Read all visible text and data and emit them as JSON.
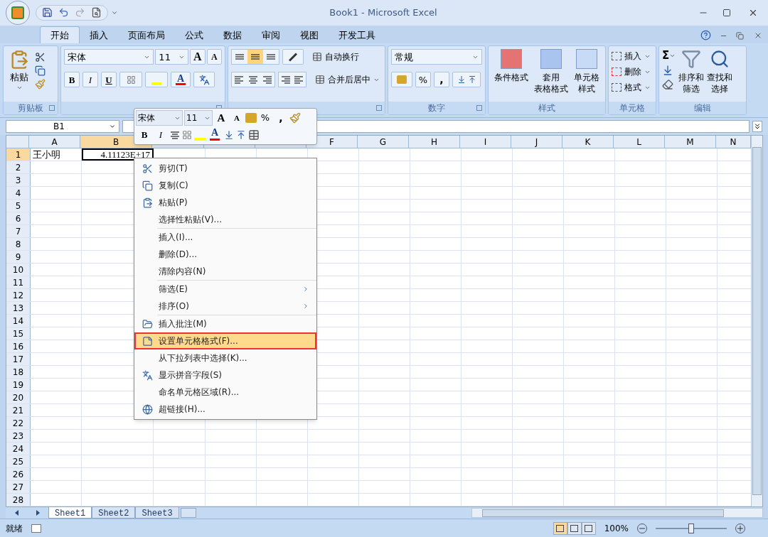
{
  "window": {
    "title": "Book1 - Microsoft Excel"
  },
  "tabs": [
    {
      "label": "开始",
      "selected": true
    },
    {
      "label": "插入",
      "selected": false
    },
    {
      "label": "页面布局",
      "selected": false
    },
    {
      "label": "公式",
      "selected": false
    },
    {
      "label": "数据",
      "selected": false
    },
    {
      "label": "审阅",
      "selected": false
    },
    {
      "label": "视图",
      "selected": false
    },
    {
      "label": "开发工具",
      "selected": false
    }
  ],
  "ribbon": {
    "clipboard": {
      "paste": "粘贴",
      "group": "剪贴板"
    },
    "font": {
      "name": "宋体",
      "size": "11",
      "grow": "A",
      "shrink": "A",
      "bold": "B",
      "italic": "I",
      "underline": "U",
      "font_color": "A"
    },
    "alignment": {
      "vertical": [
        {
          "selected": false
        },
        {
          "selected": true
        },
        {
          "selected": false
        }
      ],
      "wrap": "自动换行",
      "merge": "合并后居中"
    },
    "number": {
      "format": "常规",
      "percent": "%",
      "comma": ",",
      "group": "数字"
    },
    "styles": {
      "buttons": [
        {
          "lines": [
            "条件格式"
          ]
        },
        {
          "lines": [
            "套用",
            "表格格式"
          ]
        },
        {
          "lines": [
            "单元格",
            "样式"
          ]
        }
      ],
      "group": "样式"
    },
    "cells": {
      "buttons": [
        "插入",
        "删除",
        "格式"
      ],
      "group": "单元格"
    },
    "editing": {
      "sum": "Σ",
      "buttons": [
        {
          "lines": [
            "排序和",
            "筛选"
          ]
        },
        {
          "lines": [
            "查找和",
            "选择"
          ]
        }
      ],
      "group": "编辑"
    }
  },
  "formula_bar": {
    "name_box": "B1"
  },
  "sheet": {
    "columns": [
      {
        "label": "A",
        "selected": false
      },
      {
        "label": "B",
        "selected": true
      },
      {
        "selected": false
      },
      {
        "selected": false
      },
      {
        "selected": false
      },
      {
        "label": "F",
        "selected": false
      },
      {
        "label": "G",
        "selected": false
      },
      {
        "label": "H",
        "selected": false
      },
      {
        "label": "I",
        "selected": false
      },
      {
        "label": "J",
        "selected": false
      },
      {
        "label": "K",
        "selected": false
      },
      {
        "label": "L",
        "selected": false
      },
      {
        "label": "M",
        "selected": false
      },
      {
        "label": "N",
        "selected": false
      }
    ],
    "rows": [
      {
        "label": "1",
        "selected": true,
        "cells": [
          {
            "text": "王小明",
            "selected": false
          },
          {
            "text": "4.11123E+17",
            "selected": true
          }
        ]
      },
      {
        "label": "2",
        "selected": false
      },
      {
        "label": "3",
        "selected": false
      },
      {
        "label": "4",
        "selected": false
      },
      {
        "label": "5",
        "selected": false
      },
      {
        "label": "6",
        "selected": false
      },
      {
        "label": "7",
        "selected": false
      },
      {
        "label": "8",
        "selected": false
      },
      {
        "label": "9",
        "selected": false
      },
      {
        "label": "10",
        "selected": false
      },
      {
        "label": "11",
        "selected": false
      },
      {
        "label": "12",
        "selected": false
      },
      {
        "label": "13",
        "selected": false
      },
      {
        "label": "14",
        "selected": false
      },
      {
        "label": "15",
        "selected": false
      },
      {
        "label": "16",
        "selected": false
      },
      {
        "label": "17",
        "selected": false
      },
      {
        "label": "18",
        "selected": false
      },
      {
        "label": "19",
        "selected": false
      },
      {
        "label": "20",
        "selected": false
      },
      {
        "label": "21",
        "selected": false
      },
      {
        "label": "22",
        "selected": false
      },
      {
        "label": "23",
        "selected": false
      },
      {
        "label": "24",
        "selected": false
      },
      {
        "label": "25",
        "selected": false
      },
      {
        "label": "26",
        "selected": false
      },
      {
        "label": "27",
        "selected": false
      },
      {
        "label": "28",
        "selected": false
      }
    ]
  },
  "mini_toolbar": {
    "font": "宋体",
    "size": "11",
    "grow": "A",
    "shrink": "A",
    "percent": "%",
    "comma": ",",
    "bold": "B",
    "italic": "I",
    "font_color": "A"
  },
  "context_menu": {
    "groups": [
      [
        {
          "label": "剪切(T)",
          "selected": false,
          "submenu": false
        },
        {
          "label": "复制(C)",
          "selected": false,
          "submenu": false
        },
        {
          "label": "粘贴(P)",
          "selected": false,
          "submenu": false
        },
        {
          "label": "选择性粘贴(V)...",
          "selected": false,
          "submenu": false
        }
      ],
      [
        {
          "label": "插入(I)...",
          "selected": false,
          "submenu": false
        },
        {
          "label": "删除(D)...",
          "selected": false,
          "submenu": false
        },
        {
          "label": "清除内容(N)",
          "selected": false,
          "submenu": false
        }
      ],
      [
        {
          "label": "筛选(E)",
          "selected": false,
          "submenu": true
        },
        {
          "label": "排序(O)",
          "selected": false,
          "submenu": true
        }
      ],
      [
        {
          "label": "插入批注(M)",
          "selected": false,
          "submenu": false
        },
        {
          "label": "设置单元格格式(F)...",
          "selected": true,
          "submenu": false
        },
        {
          "label": "从下拉列表中选择(K)...",
          "selected": false,
          "submenu": false
        },
        {
          "label": "显示拼音字段(S)",
          "selected": false,
          "submenu": false
        },
        {
          "label": "命名单元格区域(R)...",
          "selected": false,
          "submenu": false
        },
        {
          "label": "超链接(H)...",
          "selected": false,
          "submenu": false
        }
      ]
    ]
  },
  "sheet_tabs": [
    {
      "label": "Sheet1",
      "selected": true
    },
    {
      "label": "Sheet2",
      "selected": false
    },
    {
      "label": "Sheet3",
      "selected": false
    }
  ],
  "status_bar": {
    "status": "就绪",
    "views": [
      {
        "selected": true
      },
      {
        "selected": false
      },
      {
        "selected": false
      }
    ],
    "zoom": "100%",
    "zoom_level": {
      "level": 0.5
    }
  }
}
